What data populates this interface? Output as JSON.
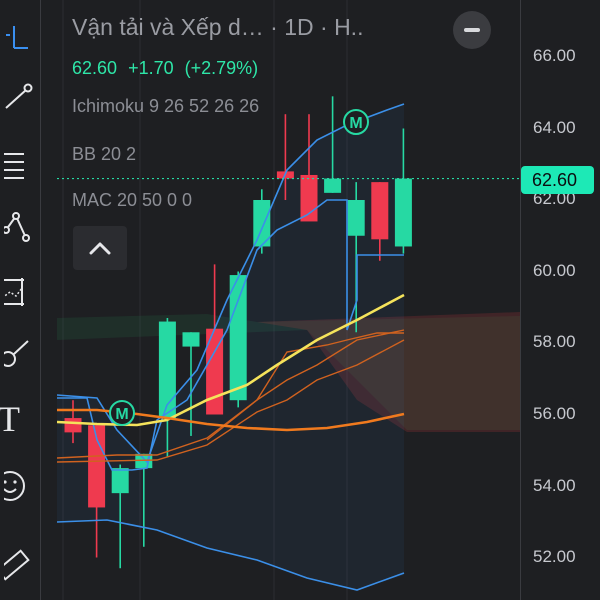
{
  "toolbar": {
    "tools": [
      {
        "icon": "crosshair-icon"
      },
      {
        "icon": "trend-line-icon"
      },
      {
        "icon": "fib-retracement-icon"
      },
      {
        "icon": "pattern-icon"
      },
      {
        "icon": "prediction-icon"
      },
      {
        "icon": "brush-icon"
      },
      {
        "icon": "text-icon",
        "label": "T"
      },
      {
        "icon": "emoji-icon"
      },
      {
        "icon": "ruler-icon"
      }
    ]
  },
  "header": {
    "title": "Vận tải và Xếp d… · 1D · H..",
    "last_price": "62.60",
    "change": "+1.70",
    "change_pct": "(+2.79%)"
  },
  "indicators": [
    {
      "label": "Ichimoku 9 26 52 26 26"
    },
    {
      "label": "BB 20 2"
    },
    {
      "label": "MAC 20 50 0 0"
    }
  ],
  "price_axis": {
    "ticks": [
      "66.00",
      "64.00",
      "62.00",
      "60.00",
      "58.00",
      "56.00",
      "54.00",
      "52.00"
    ],
    "current_price_label": "62.60"
  },
  "markers": [
    {
      "label": "M"
    },
    {
      "label": "M"
    }
  ],
  "colors": {
    "up": "#26d9a3",
    "down": "#ef3a4f",
    "ma_fast": "#f5e35b",
    "ma_slow": "#f07a1e",
    "bb": "#3b8fe8",
    "price_line": "#26d9a3",
    "background": "#1e1f22"
  },
  "chart_data": {
    "type": "candlestick",
    "ylim": [
      51.3,
      66.5
    ],
    "candles": [
      {
        "o": 55.9,
        "h": 56.4,
        "l": 55.2,
        "c": 55.5,
        "dir": "down"
      },
      {
        "o": 55.7,
        "h": 55.7,
        "l": 52.0,
        "c": 53.4,
        "dir": "down"
      },
      {
        "o": 53.8,
        "h": 54.6,
        "l": 51.7,
        "c": 54.5,
        "dir": "up"
      },
      {
        "o": 54.5,
        "h": 54.9,
        "l": 52.3,
        "c": 54.9,
        "dir": "up"
      },
      {
        "o": 55.9,
        "h": 58.7,
        "l": 54.8,
        "c": 58.6,
        "dir": "up"
      },
      {
        "o": 57.9,
        "h": 58.3,
        "l": 55.4,
        "c": 58.3,
        "dir": "up"
      },
      {
        "o": 58.4,
        "h": 60.2,
        "l": 56.2,
        "c": 56.0,
        "dir": "down"
      },
      {
        "o": 56.4,
        "h": 60.0,
        "l": 56.2,
        "c": 59.9,
        "dir": "up"
      },
      {
        "o": 60.7,
        "h": 62.3,
        "l": 60.5,
        "c": 62.0,
        "dir": "up"
      },
      {
        "o": 62.8,
        "h": 64.4,
        "l": 62.0,
        "c": 62.6,
        "dir": "down"
      },
      {
        "o": 62.7,
        "h": 64.4,
        "l": 61.7,
        "c": 61.4,
        "dir": "down"
      },
      {
        "o": 62.2,
        "h": 64.9,
        "l": 62.2,
        "c": 62.6,
        "dir": "up"
      },
      {
        "o": 61.0,
        "h": 62.5,
        "l": 58.3,
        "c": 62.0,
        "dir": "up"
      },
      {
        "o": 62.5,
        "h": 62.5,
        "l": 60.3,
        "c": 60.9,
        "dir": "down"
      },
      {
        "o": 60.7,
        "h": 64.0,
        "l": 60.5,
        "c": 62.6,
        "dir": "up"
      }
    ]
  }
}
